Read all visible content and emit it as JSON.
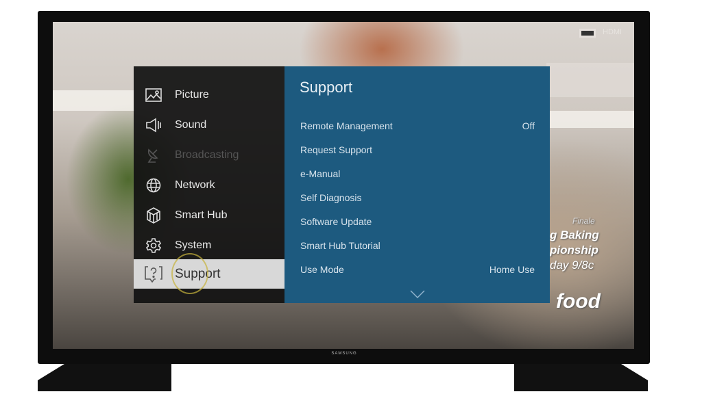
{
  "tv": {
    "brand": "SAMSUNG",
    "input_label": "HDMI"
  },
  "broadcast_overlay": {
    "lines": [
      "Finale",
      "g Baking",
      "pionship",
      "day 9/8c"
    ],
    "logo": "food"
  },
  "menu": {
    "items": [
      {
        "label": "Picture",
        "icon": "picture-icon",
        "state": "normal"
      },
      {
        "label": "Sound",
        "icon": "speaker-icon",
        "state": "normal"
      },
      {
        "label": "Broadcasting",
        "icon": "satellite-dish-icon",
        "state": "disabled"
      },
      {
        "label": "Network",
        "icon": "globe-icon",
        "state": "normal"
      },
      {
        "label": "Smart Hub",
        "icon": "cube-icon",
        "state": "normal"
      },
      {
        "label": "System",
        "icon": "gear-icon",
        "state": "normal"
      },
      {
        "label": "Support",
        "icon": "help-bubble-icon",
        "state": "selected"
      }
    ]
  },
  "submenu": {
    "title": "Support",
    "items": [
      {
        "label": "Remote Management",
        "value": "Off"
      },
      {
        "label": "Request Support",
        "value": ""
      },
      {
        "label": "e-Manual",
        "value": ""
      },
      {
        "label": "Self Diagnosis",
        "value": ""
      },
      {
        "label": "Software Update",
        "value": ""
      },
      {
        "label": "Smart Hub Tutorial",
        "value": ""
      },
      {
        "label": "Use Mode",
        "value": "Home Use"
      }
    ],
    "more_indicator": "chevron-down-icon"
  },
  "colors": {
    "submenu_bg": "#1d5a7f",
    "menu_bg": "#121212",
    "selected_bg": "#d8d8d8"
  }
}
